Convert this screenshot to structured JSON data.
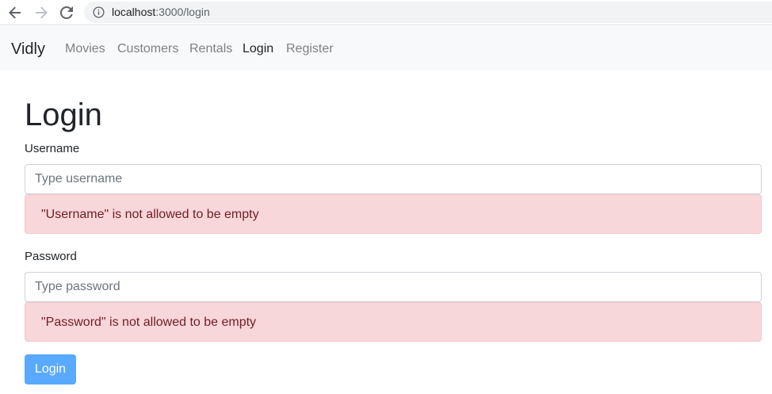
{
  "browser": {
    "url_host": "localhost",
    "url_path": ":3000/login",
    "icons": {
      "back": "arrow-left-icon",
      "forward": "arrow-right-icon",
      "reload": "reload-icon",
      "info": "info-icon"
    }
  },
  "navbar": {
    "brand": "Vidly",
    "links": [
      {
        "label": "Movies",
        "active": false
      },
      {
        "label": "Customers",
        "active": false
      },
      {
        "label": "Rentals",
        "active": false
      },
      {
        "label": "Login",
        "active": true
      },
      {
        "label": "Register",
        "active": false
      }
    ]
  },
  "page": {
    "title": "Login"
  },
  "form": {
    "username": {
      "label": "Username",
      "value": "",
      "placeholder": "Type username",
      "error": "\"Username\" is not allowed to be empty"
    },
    "password": {
      "label": "Password",
      "value": "",
      "placeholder": "Type password",
      "error": "\"Password\" is not allowed to be empty"
    },
    "submit_label": "Login"
  },
  "colors": {
    "navbar_bg": "#f8f9fa",
    "alert_bg": "#f8d7da",
    "alert_text": "#721c24",
    "button_bg": "#59a9ff",
    "link_muted": "#808080",
    "link_active": "#212529"
  }
}
